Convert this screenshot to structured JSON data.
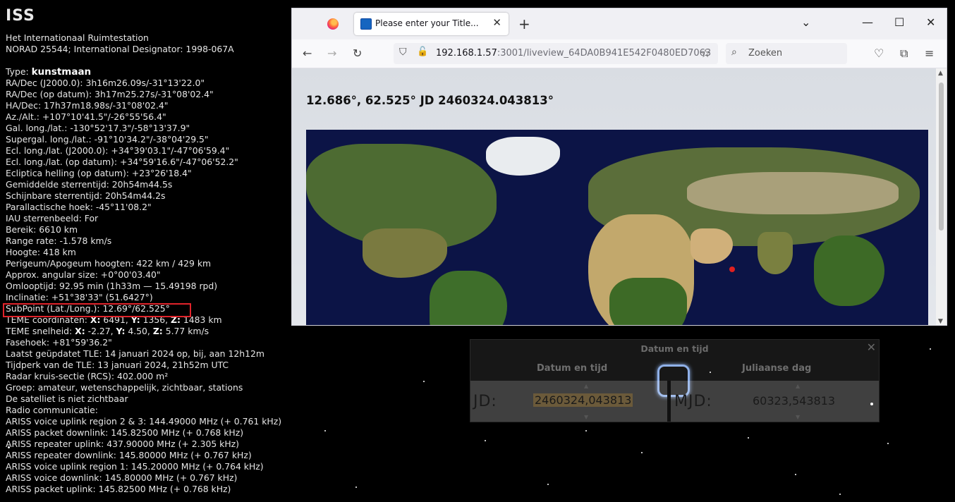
{
  "info": {
    "title": "ISS",
    "lines_top": [
      "Het Internationaal Ruimtestation",
      "NORAD 25544; International Designator: 1998-067A"
    ],
    "type_label": "Type: ",
    "type_value": "kunstmaan",
    "lines": [
      "RA/Dec (J2000.0): 3h16m26.09s/-31°13'22.0\"",
      "RA/Dec (op datum): 3h17m25.27s/-31°08'02.4\"",
      "HA/Dec: 17h37m18.98s/-31°08'02.4\"",
      "Az./Alt.: +107°10'41.5\"/-26°55'56.4\"",
      "Gal. long./lat.: -130°52'17.3\"/-58°13'37.9\"",
      "Supergal. long./lat.: -91°10'34.2\"/-38°04'29.5\"",
      "Ecl. long./lat. (J2000.0): +34°39'03.1\"/-47°06'59.4\"",
      "Ecl. long./lat. (op datum): +34°59'16.6\"/-47°06'52.2\"",
      "Ecliptica helling (op datum): +23°26'18.4\"",
      "Gemiddelde sterrentijd: 20h54m44.5s",
      "Schijnbare sterrentijd: 20h54m44.2s",
      "Parallactische hoek: -45°11'08.2\"",
      "IAU sterrenbeeld: For",
      "Bereik: 6610 km",
      "Range rate: -1.578 km/s",
      "Hoogte: 418 km",
      "Perigeum/Apogeum hoogten: 422 km / 429 km",
      "Approx. angular size: +0°00'03.40\"",
      "Omlooptijd: 92.95 min (1h33m — 15.49198 rpd)",
      "Inclinatie: +51°38'33\" (51.6427°)",
      "SubPoint (Lat./Long.): 12.69°/62.525°"
    ],
    "teme_coords": {
      "label": "TEME coördinaten: ",
      "x_lbl": "X:",
      "x": " 6491, ",
      "y_lbl": "Y:",
      "y": " 1356, ",
      "z_lbl": "Z:",
      "z": " 1483 km"
    },
    "teme_speed": {
      "label": "TEME snelheid: ",
      "x_lbl": "X:",
      "x": " -2.27, ",
      "y_lbl": "Y:",
      "y": " 4.50, ",
      "z_lbl": "Z:",
      "z": " 5.77 km/s"
    },
    "lines_bottom": [
      "Fasehoek: +81°59'36.2\"",
      "Laatst geüpdatet TLE: 14 januari 2024 op, bij, aan 12h12m",
      "Tijdperk van de TLE: 13 januari 2024, 21h52m UTC",
      "Radar kruis-sectie (RCS): 402.000 m²",
      "Groep: amateur, wetenschappelijk, zichtbaar, stations",
      "De satelliet is niet zichtbaar",
      "Radio communicatie:",
      "ARISS voice uplink region 2 & 3: 144.49000 MHz (+ 0.761 kHz)",
      "ARISS packet downlink: 145.82500 MHz (+ 0.768 kHz)",
      "ARISS repeater uplink: 437.90000 MHz (+ 2.305 kHz)",
      "ARISS repeater downlink: 145.80000 MHz (+ 0.767 kHz)",
      "ARISS voice uplink region 1: 145.20000 MHz (+ 0.764 kHz)",
      "ARISS voice downlink: 145.80000 MHz (+ 0.767 kHz)",
      "ARISS packet uplink: 145.82500 MHz (+ 0.768 kHz)"
    ]
  },
  "browser": {
    "tab_title": "Please enter your Title...",
    "url_host": "192.168.1.57",
    "url_rest": ":3001/liveview_64DA0B941E542F0480ED7063",
    "search_placeholder": "Zoeken",
    "page_coords": "12.686°, 62.525° JD 2460324.043813°"
  },
  "dialog": {
    "title": "Datum en tijd",
    "tab_left": "Datum en tijd",
    "tab_right": "Juliaanse dag",
    "jd_label": "JD:",
    "jd_value": "2460324,043813",
    "mjd_label": "MJD:",
    "mjd_value": "60323,543813"
  },
  "colors": {
    "highlight_border": "#e0232a",
    "iss_marker": "#e02020",
    "ocean": "#0c1446"
  }
}
